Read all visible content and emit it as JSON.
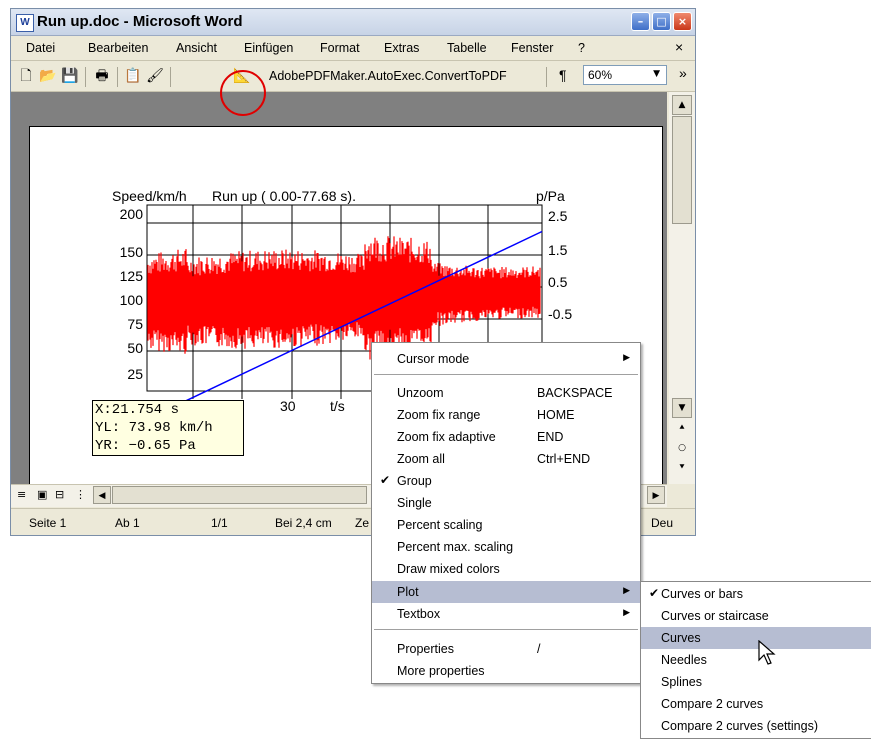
{
  "window": {
    "title": "Run up.doc - Microsoft Word",
    "app_icon": "W",
    "minimize": "–",
    "maximize": "□",
    "close": "×"
  },
  "menubar": {
    "items": [
      "Datei",
      "Bearbeiten",
      "Ansicht",
      "Einfügen",
      "Format",
      "Extras",
      "Tabelle",
      "Fenster",
      "?"
    ],
    "close_doc": "×"
  },
  "toolbar": {
    "macro_label": "AdobePDFMaker.AutoExec.ConvertToPDF",
    "pilcrow": "¶",
    "zoom": "60%",
    "overflow": "»"
  },
  "chart_data": {
    "type": "line",
    "title": "Run up ( 0.00-77.68 s).",
    "ylabel_left": "Speed/km/h",
    "ylabel_right": "p/Pa",
    "xlabel": "t/s",
    "left_ticks": [
      "200",
      "150",
      "125",
      "100",
      "75",
      "50",
      "25"
    ],
    "right_ticks": [
      "2.5",
      "1.5",
      "0.5",
      "-0.5"
    ],
    "x_tick_label": "30",
    "series": [
      {
        "name": "",
        "color": "#ff0000",
        "kind": "noise-band"
      },
      {
        "name": "",
        "color": "#0000ff",
        "kind": "trend",
        "x": [
          0,
          77.68
        ],
        "y_right": [
          -2.1,
          2.3
        ]
      }
    ]
  },
  "readout": {
    "x": "X:21.754 s",
    "yl": "YL: 73.98 km/h",
    "yr": "YR: −0.65 Pa"
  },
  "statusbar": {
    "page": "Seite 1",
    "section": "Ab 1",
    "pages": "1/1",
    "position": "Bei 2,4 cm",
    "line": "Ze",
    "lang": "Deu"
  },
  "context_menu": {
    "items": [
      {
        "label": "Cursor mode",
        "key": "",
        "submenu": true,
        "checked": false
      },
      {
        "label": "Unzoom",
        "key": "BACKSPACE",
        "submenu": false,
        "checked": false
      },
      {
        "label": "Zoom fix range",
        "key": "HOME",
        "submenu": false,
        "checked": false
      },
      {
        "label": "Zoom fix adaptive",
        "key": "END",
        "submenu": false,
        "checked": false
      },
      {
        "label": "Zoom all",
        "key": "Ctrl+END",
        "submenu": false,
        "checked": false
      },
      {
        "label": "Group",
        "key": "",
        "submenu": false,
        "checked": true
      },
      {
        "label": "Single",
        "key": "",
        "submenu": false,
        "checked": false
      },
      {
        "label": "Percent scaling",
        "key": "",
        "submenu": false,
        "checked": false
      },
      {
        "label": "Percent max. scaling",
        "key": "",
        "submenu": false,
        "checked": false
      },
      {
        "label": "Draw mixed colors",
        "key": "",
        "submenu": false,
        "checked": false
      },
      {
        "label": "Plot",
        "key": "",
        "submenu": true,
        "checked": false
      },
      {
        "label": "Textbox",
        "key": "",
        "submenu": true,
        "checked": false
      },
      {
        "label": "Properties",
        "key": "/",
        "submenu": false,
        "checked": false
      },
      {
        "label": "More properties",
        "key": "",
        "submenu": false,
        "checked": false
      }
    ]
  },
  "plot_submenu": {
    "items": [
      {
        "label": "Curves or bars",
        "checked": true
      },
      {
        "label": "Curves or staircase",
        "checked": false
      },
      {
        "label": "Curves",
        "checked": false
      },
      {
        "label": "Needles",
        "checked": false
      },
      {
        "label": "Splines",
        "checked": false
      },
      {
        "label": "Compare 2 curves",
        "checked": false
      },
      {
        "label": "Compare 2 curves  (settings)",
        "checked": false
      }
    ]
  },
  "colors": {
    "highlight": "#b6bdd2",
    "signal": "#ff0000",
    "trend": "#0000ff",
    "annotation": "#e00000"
  }
}
